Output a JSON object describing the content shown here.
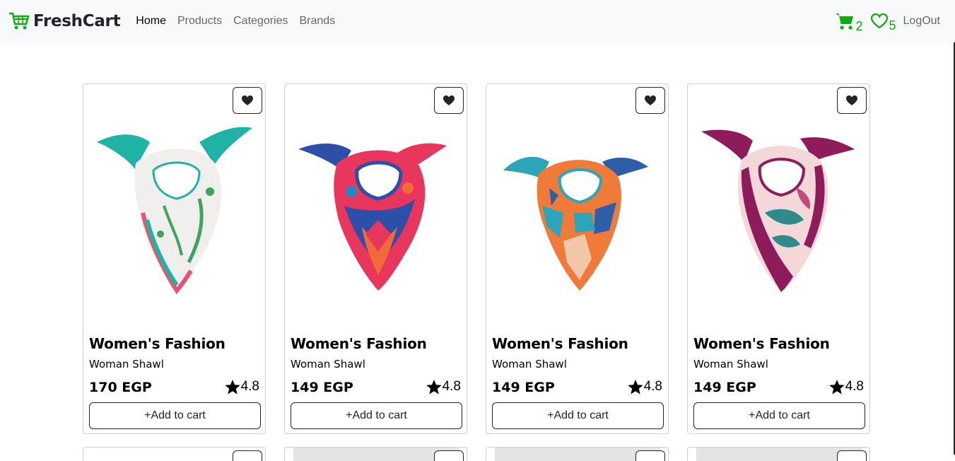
{
  "navbar": {
    "brand": "FreshCart",
    "links": [
      {
        "label": "Home",
        "active": true
      },
      {
        "label": "Products",
        "active": false
      },
      {
        "label": "Categories",
        "active": false
      },
      {
        "label": "Brands",
        "active": false
      }
    ],
    "cart_count": "2",
    "wishlist_count": "5",
    "logout": "LogOut",
    "accent_color": "#0aad0a"
  },
  "products": [
    {
      "category": "Women's Fashion",
      "title": "Woman Shawl",
      "price": "170 EGP",
      "rating": "4.8",
      "add_label": "+Add to cart",
      "wish_icon": "heart-icon",
      "palette": [
        "#f2f2f2",
        "#1fb3a6",
        "#f0506e",
        "#3aa55d"
      ]
    },
    {
      "category": "Women's Fashion",
      "title": "Woman Shawl",
      "price": "149 EGP",
      "rating": "4.8",
      "add_label": "+Add to cart",
      "wish_icon": "heart-icon",
      "palette": [
        "#e8365d",
        "#2d4fa8",
        "#f06a3a",
        "#1e88c9"
      ]
    },
    {
      "category": "Women's Fashion",
      "title": "Woman Shawl",
      "price": "149 EGP",
      "rating": "4.8",
      "add_label": "+Add to cart",
      "wish_icon": "heart-icon",
      "palette": [
        "#f07a3a",
        "#2aa6b8",
        "#2d5fa8",
        "#f0c7a8"
      ]
    },
    {
      "category": "Women's Fashion",
      "title": "Woman Shawl",
      "price": "149 EGP",
      "rating": "4.8",
      "add_label": "+Add to cart",
      "wish_icon": "heart-icon",
      "palette": [
        "#8e1c5a",
        "#f3d7d9",
        "#2f8a8a",
        "#c24a7a"
      ]
    }
  ]
}
